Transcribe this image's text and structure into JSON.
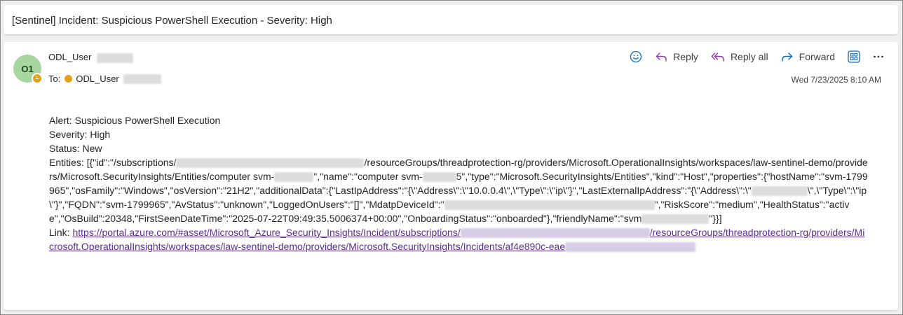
{
  "subject": "[Sentinel] Incident: Suspicious PowerShell Execution - Severity: High",
  "sender": {
    "initials": "O1",
    "name": "ODL_User",
    "to_label": "To:",
    "to_name": "ODL_User",
    "date": "Wed 7/23/2025 8:10 AM"
  },
  "actions": {
    "reply": "Reply",
    "reply_all": "Reply all",
    "forward": "Forward"
  },
  "body": {
    "alert": "Alert: Suspicious PowerShell Execution",
    "severity": "Severity: High",
    "status": "Status: New",
    "ent_1": "Entities: [{\"id\":\"/subscriptions/",
    "ent_2": "/resourceGroups/threadprotection-rg/providers/Microsoft.OperationalInsights/workspaces/law-sentinel-demo/providers/Microsoft.SecurityInsights/Entities/computer svm-",
    "ent_3": "\",\"name\":\"computer svm-",
    "ent_4": "5\",\"type\":\"Microsoft.SecurityInsights/Entities\",\"kind\":\"Host\",\"properties\":{\"hostName\":\"svm-1799965\",\"osFamily\":\"Windows\",\"osVersion\":\"21H2\",\"additionalData\":{\"LastIpAddress\":\"{\\\"Address\\\":\\\"10.0.0.4\\\",\\\"Type\\\":\\\"ip\\\"}\",\"LastExternalIpAddress\":\"{\\\"Address\\\":\\\"",
    "ent_5": "\\\",\\\"Type\\\":\\\"ip\\\"}\",\"FQDN\":\"svm-1799965\",\"AvStatus\":\"unknown\",\"LoggedOnUsers\":\"[]\",\"MdatpDeviceId\":\"",
    "ent_6": "\",\"RiskScore\":\"medium\",\"HealthStatus\":\"active\",\"OsBuild\":20348,\"FirstSeenDateTime\":\"2025-07-22T09:49:35.5006374+00:00\",\"OnboardingStatus\":\"onboarded\"},\"friendlyName\":\"svm",
    "ent_7": "\"}}]",
    "link_label": "Link: ",
    "link_1": "https://portal.azure.com/#asset/Microsoft_Azure_Security_Insights/Incident/subscriptions/",
    "link_2": "/resourceGroups/threadprotection-rg/providers/Microsoft.OperationalInsights/workspaces/law-sentinel-demo/providers/Microsoft.SecurityInsights/Incidents/af4e890c-eae"
  },
  "colors": {
    "avatar_bg": "#a8d5a0",
    "presence": "#e3a21a",
    "link": "#5b2e91",
    "accent": "#0f6cbd",
    "reply_all_accent": "#8a3ca8"
  }
}
